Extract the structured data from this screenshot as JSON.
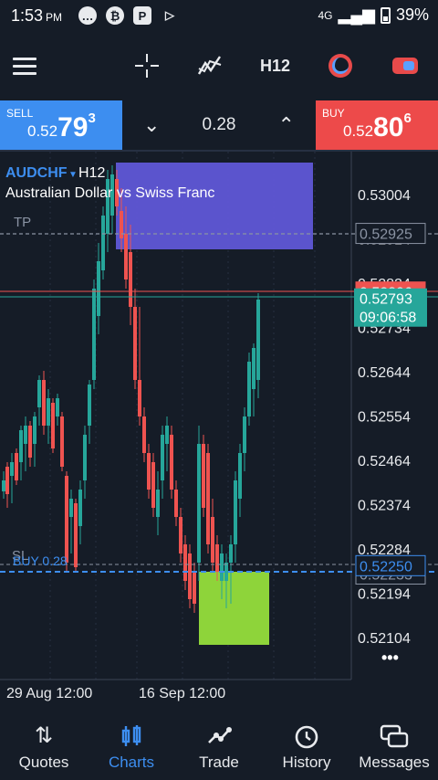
{
  "status": {
    "time": "1:53",
    "ampm": "PM",
    "network": "4G",
    "battery": "39%"
  },
  "toolbar": {
    "timeframe": "H12"
  },
  "trade": {
    "sell_label": "SELL",
    "sell_prefix": "0.52",
    "sell_big": "79",
    "sell_sup": "3",
    "buy_label": "BUY",
    "buy_prefix": "0.52",
    "buy_big": "80",
    "buy_sup": "6",
    "volume": "0.28"
  },
  "chart": {
    "symbol": "AUDCHF",
    "timeframe": "H12",
    "description": "Australian Dollar vs Swiss Franc",
    "tp_label": "TP",
    "sl_label": "SL",
    "position_label": "BUY 0.28",
    "price_labels": [
      "0.53004",
      "0.52914",
      "0.52824",
      "0.52734",
      "0.52644",
      "0.52554",
      "0.52464",
      "0.52374",
      "0.52284",
      "0.52194",
      "0.52104"
    ],
    "tp_price": "0.52925",
    "ask_price": "0.52806",
    "bid_price": "0.52793",
    "countdown": "09:06:58",
    "entry_price": "0.52250",
    "sl_price": "0.52233",
    "date_labels": [
      "29 Aug 12:00",
      "16 Sep 12:00"
    ],
    "more": "•••"
  },
  "colors": {
    "bull": "#26a69a",
    "bear": "#ef5350",
    "tp_zone": "#5f57d6",
    "sl_zone": "#8ed43a",
    "sell": "#3d8ef0",
    "buy": "#ed4a4a"
  },
  "nav": [
    {
      "label": "Quotes",
      "icon": "quotes-icon",
      "glyph": "⇅"
    },
    {
      "label": "Charts",
      "icon": "charts-icon",
      "glyph": "⧮"
    },
    {
      "label": "Trade",
      "icon": "trade-icon",
      "glyph": "⌇"
    },
    {
      "label": "History",
      "icon": "history-icon",
      "glyph": "⟲"
    },
    {
      "label": "Messages",
      "icon": "messages-icon",
      "glyph": "▭"
    }
  ]
}
